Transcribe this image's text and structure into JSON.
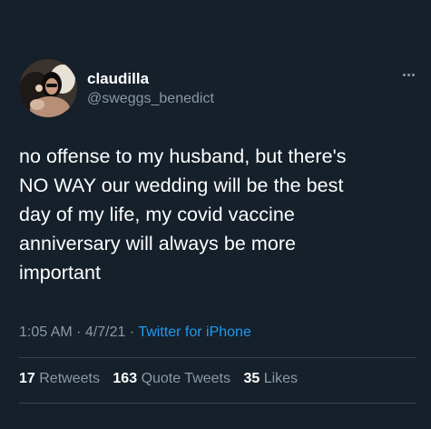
{
  "author": {
    "display_name": "claudilla",
    "handle": "@sweggs_benedict",
    "avatar_icon": "profile-photo"
  },
  "more_icon": "more-horizontal-icon",
  "tweet": {
    "text": "no offense to my husband, but there's\nNO WAY our wedding will be the best\nday of my life, my covid vaccine\nanniversary will always be more\nimportant"
  },
  "meta": {
    "time": "1:05 AM",
    "date": "4/7/21",
    "separator": " · ",
    "source": "Twitter for iPhone"
  },
  "stats": {
    "retweets_count": "17",
    "retweets_label": "Retweets",
    "quotes_count": "163",
    "quotes_label": "Quote Tweets",
    "likes_count": "35",
    "likes_label": "Likes"
  },
  "colors": {
    "background": "#15202b",
    "text_primary": "#ffffff",
    "text_secondary": "#8b98a5",
    "link": "#1d9bf0",
    "divider": "#38444d"
  }
}
